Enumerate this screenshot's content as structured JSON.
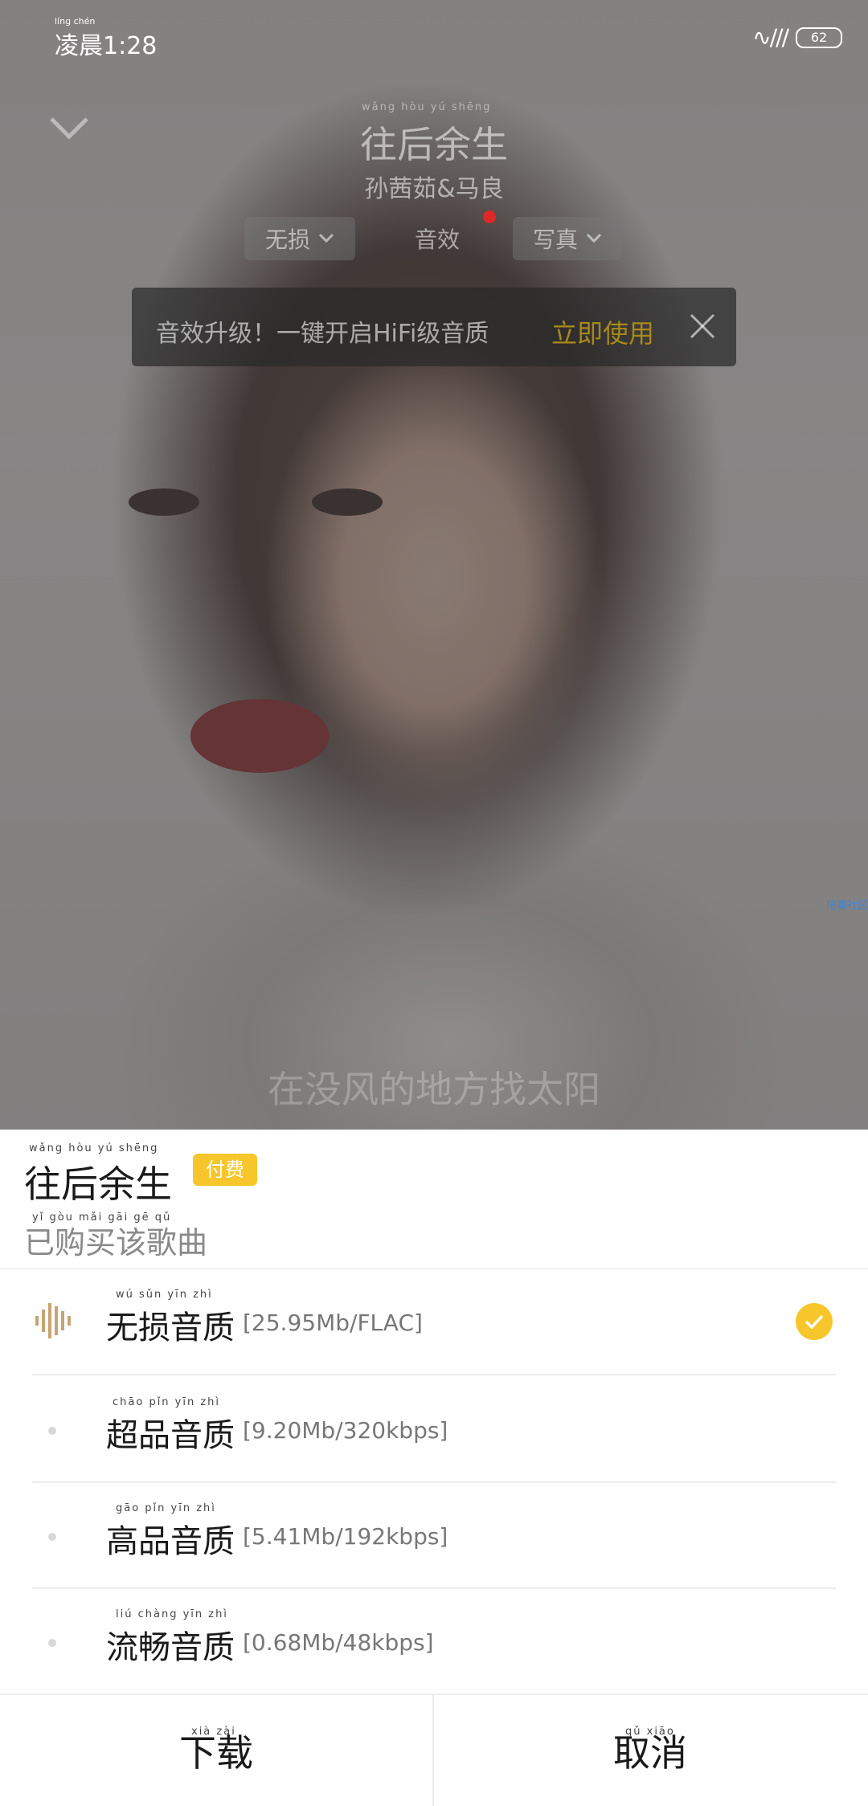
{
  "status": {
    "time": "凌晨1:28",
    "time_ruby": "líng chén",
    "battery": "62"
  },
  "player": {
    "title": "往后余生",
    "title_pinyin": "wǎng hòu yú shēng",
    "artist": "孙茜茹&马良",
    "tabs": {
      "lossless": "无损",
      "effect": "音效",
      "photo": "写真"
    },
    "promo": {
      "text": "音效升级！一键开启HiFi级音质",
      "action": "立即使用"
    },
    "community": "陪聊社区",
    "lyric": "在没风的地方找太阳"
  },
  "sheet": {
    "title": "往后余生",
    "title_pinyin": "wǎng hòu yú shēng",
    "badge": "付费",
    "purchased": "已购买该歌曲",
    "purchased_pinyin": "yǐ gòu mǎi gāi gē qǔ",
    "qualities": [
      {
        "label": "无损音质",
        "pinyin": "wú sǔn yīn zhì",
        "detail": "[25.95Mb/FLAC]",
        "selected": true
      },
      {
        "label": "超品音质",
        "pinyin": "chāo pǐn yīn zhì",
        "detail": "[9.20Mb/320kbps]",
        "selected": false
      },
      {
        "label": "高品音质",
        "pinyin": "gāo pǐn yīn zhì",
        "detail": "[5.41Mb/192kbps]",
        "selected": false
      },
      {
        "label": "流畅音质",
        "pinyin": "liú chàng yīn zhì",
        "detail": "[0.68Mb/48kbps]",
        "selected": false
      }
    ],
    "download": "下载",
    "download_pinyin": "xià zài",
    "cancel": "取消",
    "cancel_pinyin": "qǔ xiāo"
  },
  "colors": {
    "accent": "#f6c62a",
    "promo_action": "#a8891a",
    "link": "#3f86d6"
  }
}
